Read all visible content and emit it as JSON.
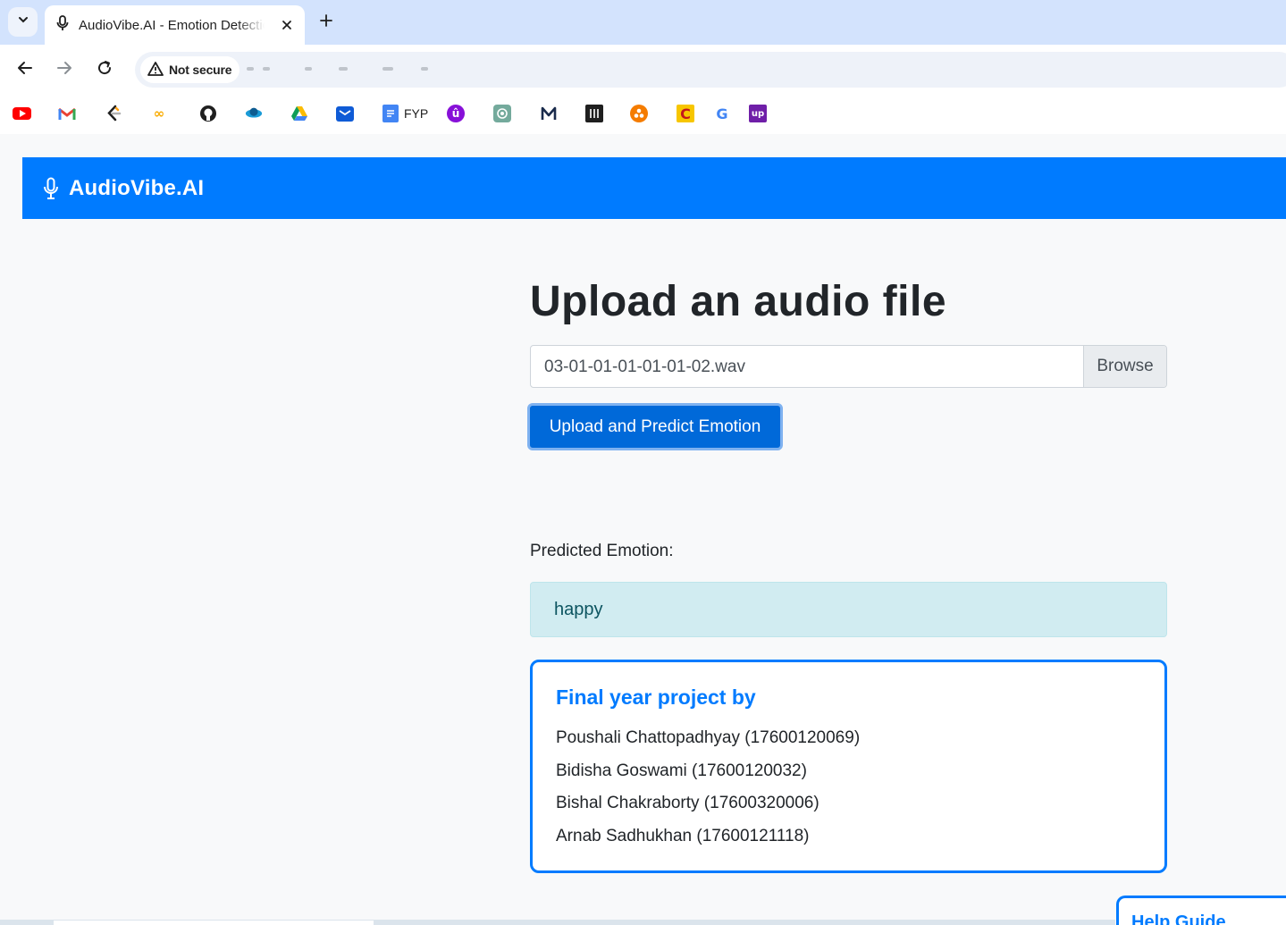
{
  "browser": {
    "tab_title": "AudioVibe.AI - Emotion Detection",
    "security_label": "Not secure",
    "bookmarks": [
      {
        "icon": "youtube-icon",
        "label": ""
      },
      {
        "icon": "gmail-icon",
        "label": ""
      },
      {
        "icon": "leetcode-icon",
        "label": ""
      },
      {
        "icon": "colab-icon",
        "label": ""
      },
      {
        "icon": "github-icon",
        "label": ""
      },
      {
        "icon": "globe-icon",
        "label": ""
      },
      {
        "icon": "google-drive-icon",
        "label": ""
      },
      {
        "icon": "mail-app-icon",
        "label": ""
      },
      {
        "icon": "docs-icon",
        "label": "FYP"
      },
      {
        "icon": "udemy-icon",
        "label": ""
      },
      {
        "icon": "chatgpt-icon",
        "label": ""
      },
      {
        "icon": "m-logo-icon",
        "label": ""
      },
      {
        "icon": "dark-square-icon",
        "label": ""
      },
      {
        "icon": "circles-icon",
        "label": ""
      },
      {
        "icon": "c-icon",
        "label": ""
      },
      {
        "icon": "google-icon",
        "label": ""
      },
      {
        "icon": "upwork-icon",
        "label": ""
      }
    ]
  },
  "navbar": {
    "brand": "AudioVibe.AI",
    "brand_icon": "microphone-icon"
  },
  "upload": {
    "heading": "Upload an audio file",
    "file_name": "03-01-01-01-01-01-02.wav",
    "browse_label": "Browse",
    "submit_label": "Upload and Predict Emotion"
  },
  "result": {
    "label": "Predicted Emotion:",
    "emotion": "happy"
  },
  "credits": {
    "title": "Final year project by",
    "members": [
      "Poushali Chattopadhyay (17600120069)",
      "Bidisha Goswami (17600120032)",
      "Bishal Chakraborty (17600320006)",
      "Arnab Sadhukhan (17600121118)"
    ]
  },
  "help": {
    "label": "Help Guide"
  },
  "colors": {
    "primary": "#007bff",
    "alert_bg": "#d1ecf1",
    "alert_text": "#0c5460"
  }
}
